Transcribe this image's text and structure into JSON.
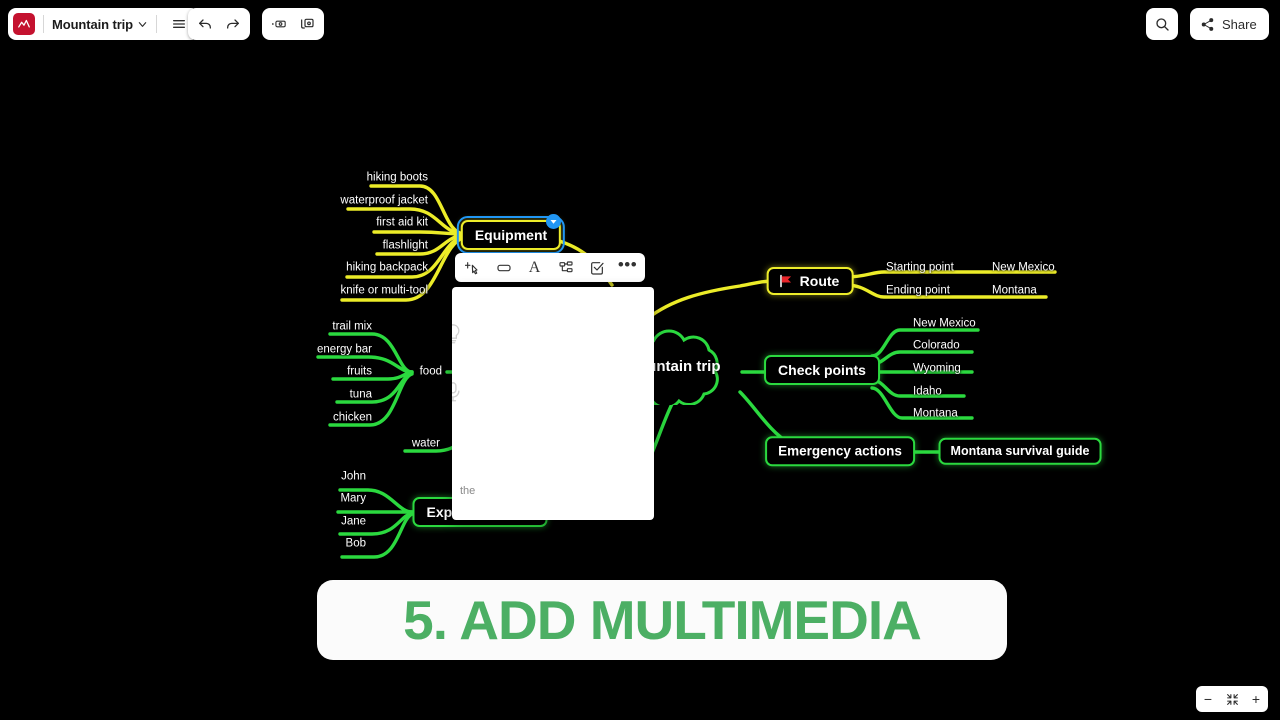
{
  "app": {
    "document_title": "Mountain trip",
    "logo_icon": "mindmap-logo-icon"
  },
  "toolbar": {
    "menu_icon": "hamburger-menu-icon",
    "undo_icon": "undo-arrow-icon",
    "redo_icon": "redo-arrow-icon",
    "insert_image_icon": "insert-image-icon",
    "insert_video_icon": "insert-video-icon",
    "search_icon": "search-icon",
    "share_label": "Share",
    "share_icon": "share-icon"
  },
  "node_toolbar": {
    "items": [
      {
        "name": "add-child-node",
        "icon": "plus-cursor-icon"
      },
      {
        "name": "node-shape",
        "icon": "rounded-rectangle-icon"
      },
      {
        "name": "text-format",
        "icon": "font-a-icon",
        "glyph": "A"
      },
      {
        "name": "node-layout",
        "icon": "hierarchy-tree-icon"
      },
      {
        "name": "task-checkbox",
        "icon": "checkbox-icon"
      },
      {
        "name": "more-options",
        "icon": "ellipsis-icon",
        "glyph": "•••"
      }
    ]
  },
  "media_panel": {
    "ghost_icons": [
      "lightbulb-icon",
      "microphone-icon"
    ],
    "text": "the"
  },
  "mindmap": {
    "center": {
      "label": "Mountain trip"
    },
    "equipment": {
      "label": "Equipment",
      "selected": true,
      "collapse_icon": "collapse-triangle-icon",
      "children": [
        "hiking boots",
        "waterproof jacket",
        "first aid kit",
        "flashlight",
        "hiking backpack",
        "knife or multi-tool"
      ]
    },
    "food": {
      "label": "food",
      "children": [
        "trail mix",
        "energy bar",
        "fruits",
        "tuna",
        "chicken"
      ]
    },
    "water": {
      "label": "water"
    },
    "expedition": {
      "label": "Expe",
      "children": [
        "John",
        "Mary",
        "Jane",
        "Bob"
      ]
    },
    "route": {
      "label": "Route",
      "icon": "red-flag-icon",
      "children": [
        {
          "label": "Starting point",
          "value": "New Mexico"
        },
        {
          "label": "Ending point",
          "value": "Montana"
        }
      ]
    },
    "checkpoints": {
      "label": "Check points",
      "children": [
        "New Mexico",
        "Colorado",
        "Wyoming",
        "Idaho",
        "Montana"
      ]
    },
    "emergency": {
      "label": "Emergency actions",
      "children": [
        "Montana survival guide"
      ]
    }
  },
  "caption": {
    "text": "5. ADD MULTIMEDIA"
  },
  "zoom_controls": {
    "zoom_out_label": "−",
    "fit_icon": "fit-to-screen-icon",
    "zoom_in_label": "+"
  },
  "colors": {
    "background": "#000000",
    "branch_yellow": "#ecec28",
    "branch_green": "#2bd93f",
    "selection_blue": "#2196f3",
    "caption_green": "#4caf64",
    "logo_red": "#c4122f"
  }
}
